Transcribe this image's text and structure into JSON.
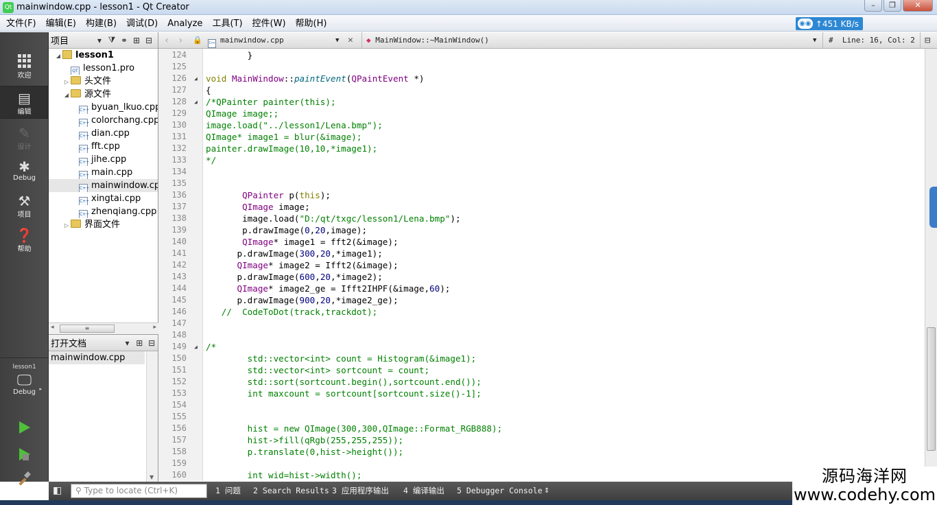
{
  "window": {
    "title": "mainwindow.cpp - lesson1 - Qt Creator",
    "controls": [
      "–",
      "❐",
      "✕"
    ]
  },
  "menu": [
    "文件(F)",
    "编辑(E)",
    "构建(B)",
    "调试(D)",
    "Analyze",
    "工具(T)",
    "控件(W)",
    "帮助(H)"
  ],
  "net_badge": {
    "speed": "↑451 KB/s"
  },
  "modes": [
    {
      "id": "welcome",
      "label": "欢迎"
    },
    {
      "id": "edit",
      "label": "编辑"
    },
    {
      "id": "design",
      "label": "设计"
    },
    {
      "id": "debug",
      "label": "Debug"
    },
    {
      "id": "projects",
      "label": "项目"
    },
    {
      "id": "help",
      "label": "帮助"
    }
  ],
  "kit": {
    "project": "lesson1",
    "build": "Debug"
  },
  "project_panel": {
    "title": "项目",
    "tree": [
      {
        "label": "lesson1",
        "level": 0,
        "kind": "project",
        "expanded": true
      },
      {
        "label": "lesson1.pro",
        "level": 1,
        "kind": "pro"
      },
      {
        "label": "头文件",
        "level": 1,
        "kind": "folder",
        "expanded": false
      },
      {
        "label": "源文件",
        "level": 1,
        "kind": "folder",
        "expanded": true
      },
      {
        "label": "byuan_lkuo.cpp",
        "level": 2,
        "kind": "cpp"
      },
      {
        "label": "colorchang.cpp",
        "level": 2,
        "kind": "cpp"
      },
      {
        "label": "dian.cpp",
        "level": 2,
        "kind": "cpp"
      },
      {
        "label": "fft.cpp",
        "level": 2,
        "kind": "cpp"
      },
      {
        "label": "jihe.cpp",
        "level": 2,
        "kind": "cpp"
      },
      {
        "label": "main.cpp",
        "level": 2,
        "kind": "cpp"
      },
      {
        "label": "mainwindow.cpp",
        "level": 2,
        "kind": "cpp",
        "selected": true
      },
      {
        "label": "xingtai.cpp",
        "level": 2,
        "kind": "cpp"
      },
      {
        "label": "zhenqiang.cpp",
        "level": 2,
        "kind": "cpp"
      },
      {
        "label": "界面文件",
        "level": 1,
        "kind": "folder",
        "expanded": false
      }
    ]
  },
  "open_docs": {
    "title": "打开文档",
    "items": [
      "mainwindow.cpp"
    ]
  },
  "editor": {
    "file": "mainwindow.cpp",
    "symbol": "MainWindow::~MainWindow()",
    "position": "Line: 16, Col: 2",
    "lines": [
      {
        "n": "124",
        "code": [
          [
            "        }",
            "def"
          ]
        ]
      },
      {
        "n": "125",
        "code": []
      },
      {
        "n": "126",
        "fold": true,
        "code": [
          [
            "void",
            "kw"
          ],
          [
            " ",
            "def"
          ],
          [
            "MainWindow",
            "ty"
          ],
          [
            "::",
            "def"
          ],
          [
            "paintEvent",
            "fn"
          ],
          [
            "(",
            "def"
          ],
          [
            "QPaintEvent",
            "ty"
          ],
          [
            " *)",
            "def"
          ]
        ]
      },
      {
        "n": "127",
        "code": [
          [
            "{",
            "def"
          ]
        ]
      },
      {
        "n": "128",
        "fold": true,
        "code": [
          [
            "/*QPainter painter(this);",
            "cm"
          ]
        ]
      },
      {
        "n": "129",
        "code": [
          [
            "QImage image;;",
            "cm"
          ]
        ]
      },
      {
        "n": "130",
        "code": [
          [
            "image.load(\"../lesson1/Lena.bmp\");",
            "cm"
          ]
        ]
      },
      {
        "n": "131",
        "code": [
          [
            "QImage* image1 = blur(&image);",
            "cm"
          ]
        ]
      },
      {
        "n": "132",
        "code": [
          [
            "painter.drawImage(10,10,*image1);",
            "cm"
          ]
        ]
      },
      {
        "n": "133",
        "code": [
          [
            "*/",
            "cm"
          ]
        ]
      },
      {
        "n": "134",
        "code": []
      },
      {
        "n": "135",
        "code": []
      },
      {
        "n": "136",
        "code": [
          [
            "       ",
            "def"
          ],
          [
            "QPainter",
            "ty"
          ],
          [
            " p(",
            "def"
          ],
          [
            "this",
            "kw"
          ],
          [
            ");",
            "def"
          ]
        ]
      },
      {
        "n": "137",
        "code": [
          [
            "       ",
            "def"
          ],
          [
            "QImage",
            "ty"
          ],
          [
            " image;",
            "def"
          ]
        ]
      },
      {
        "n": "138",
        "code": [
          [
            "       image.load(",
            "def"
          ],
          [
            "\"D:/qt/txgc/lesson1/Lena.bmp\"",
            "str"
          ],
          [
            ");",
            "def"
          ]
        ]
      },
      {
        "n": "139",
        "code": [
          [
            "       p.drawImage(",
            "def"
          ],
          [
            "0",
            "num"
          ],
          [
            ",",
            "def"
          ],
          [
            "20",
            "num"
          ],
          [
            ",image);",
            "def"
          ]
        ]
      },
      {
        "n": "140",
        "code": [
          [
            "       ",
            "def"
          ],
          [
            "QImage",
            "ty"
          ],
          [
            "* image1 = fft2(&image);",
            "def"
          ]
        ]
      },
      {
        "n": "141",
        "code": [
          [
            "      p.drawImage(",
            "def"
          ],
          [
            "300",
            "num"
          ],
          [
            ",",
            "def"
          ],
          [
            "20",
            "num"
          ],
          [
            ",*image1);",
            "def"
          ]
        ]
      },
      {
        "n": "142",
        "code": [
          [
            "      ",
            "def"
          ],
          [
            "QImage",
            "ty"
          ],
          [
            "* image2 = Ifft2(&image);",
            "def"
          ]
        ]
      },
      {
        "n": "143",
        "code": [
          [
            "      p.drawImage(",
            "def"
          ],
          [
            "600",
            "num"
          ],
          [
            ",",
            "def"
          ],
          [
            "20",
            "num"
          ],
          [
            ",*image2);",
            "def"
          ]
        ]
      },
      {
        "n": "144",
        "code": [
          [
            "      ",
            "def"
          ],
          [
            "QImage",
            "ty"
          ],
          [
            "* image2_ge = Ifft2IHPF(&image,",
            "def"
          ],
          [
            "60",
            "num"
          ],
          [
            ");",
            "def"
          ]
        ]
      },
      {
        "n": "145",
        "code": [
          [
            "      p.drawImage(",
            "def"
          ],
          [
            "900",
            "num"
          ],
          [
            ",",
            "def"
          ],
          [
            "20",
            "num"
          ],
          [
            ",*image2_ge);",
            "def"
          ]
        ]
      },
      {
        "n": "146",
        "code": [
          [
            "   //  CodeToDot(track,trackdot);",
            "cm"
          ]
        ]
      },
      {
        "n": "147",
        "code": []
      },
      {
        "n": "148",
        "code": []
      },
      {
        "n": "149",
        "fold": true,
        "code": [
          [
            "/*",
            "cm"
          ]
        ]
      },
      {
        "n": "150",
        "code": [
          [
            "        std::vector<int> count = Histogram(&image1);",
            "cm"
          ]
        ]
      },
      {
        "n": "151",
        "code": [
          [
            "        std::vector<int> sortcount = count;",
            "cm"
          ]
        ]
      },
      {
        "n": "152",
        "code": [
          [
            "        std::sort(sortcount.begin(),sortcount.end());",
            "cm"
          ]
        ]
      },
      {
        "n": "153",
        "code": [
          [
            "        int maxcount = sortcount[sortcount.size()-1];",
            "cm"
          ]
        ]
      },
      {
        "n": "154",
        "code": []
      },
      {
        "n": "155",
        "code": []
      },
      {
        "n": "156",
        "code": [
          [
            "        hist = new QImage(300,300,QImage::Format_RGB888);",
            "cm"
          ]
        ]
      },
      {
        "n": "157",
        "code": [
          [
            "        hist->fill(qRgb(255,255,255));",
            "cm"
          ]
        ]
      },
      {
        "n": "158",
        "code": [
          [
            "        p.translate(0,hist->height());",
            "cm"
          ]
        ]
      },
      {
        "n": "159",
        "code": []
      },
      {
        "n": "160",
        "code": [
          [
            "        int wid=hist->width();",
            "cm"
          ]
        ]
      }
    ]
  },
  "statusbar": {
    "locate_placeholder": "Type to locate (Ctrl+K)",
    "panes": [
      "1 问题",
      "2 Search Results",
      "3 应用程序输出",
      "4 编译输出",
      "5 Debugger Console"
    ]
  },
  "watermark": {
    "line1": "源码海洋网",
    "line2": "www.codehy.com"
  }
}
